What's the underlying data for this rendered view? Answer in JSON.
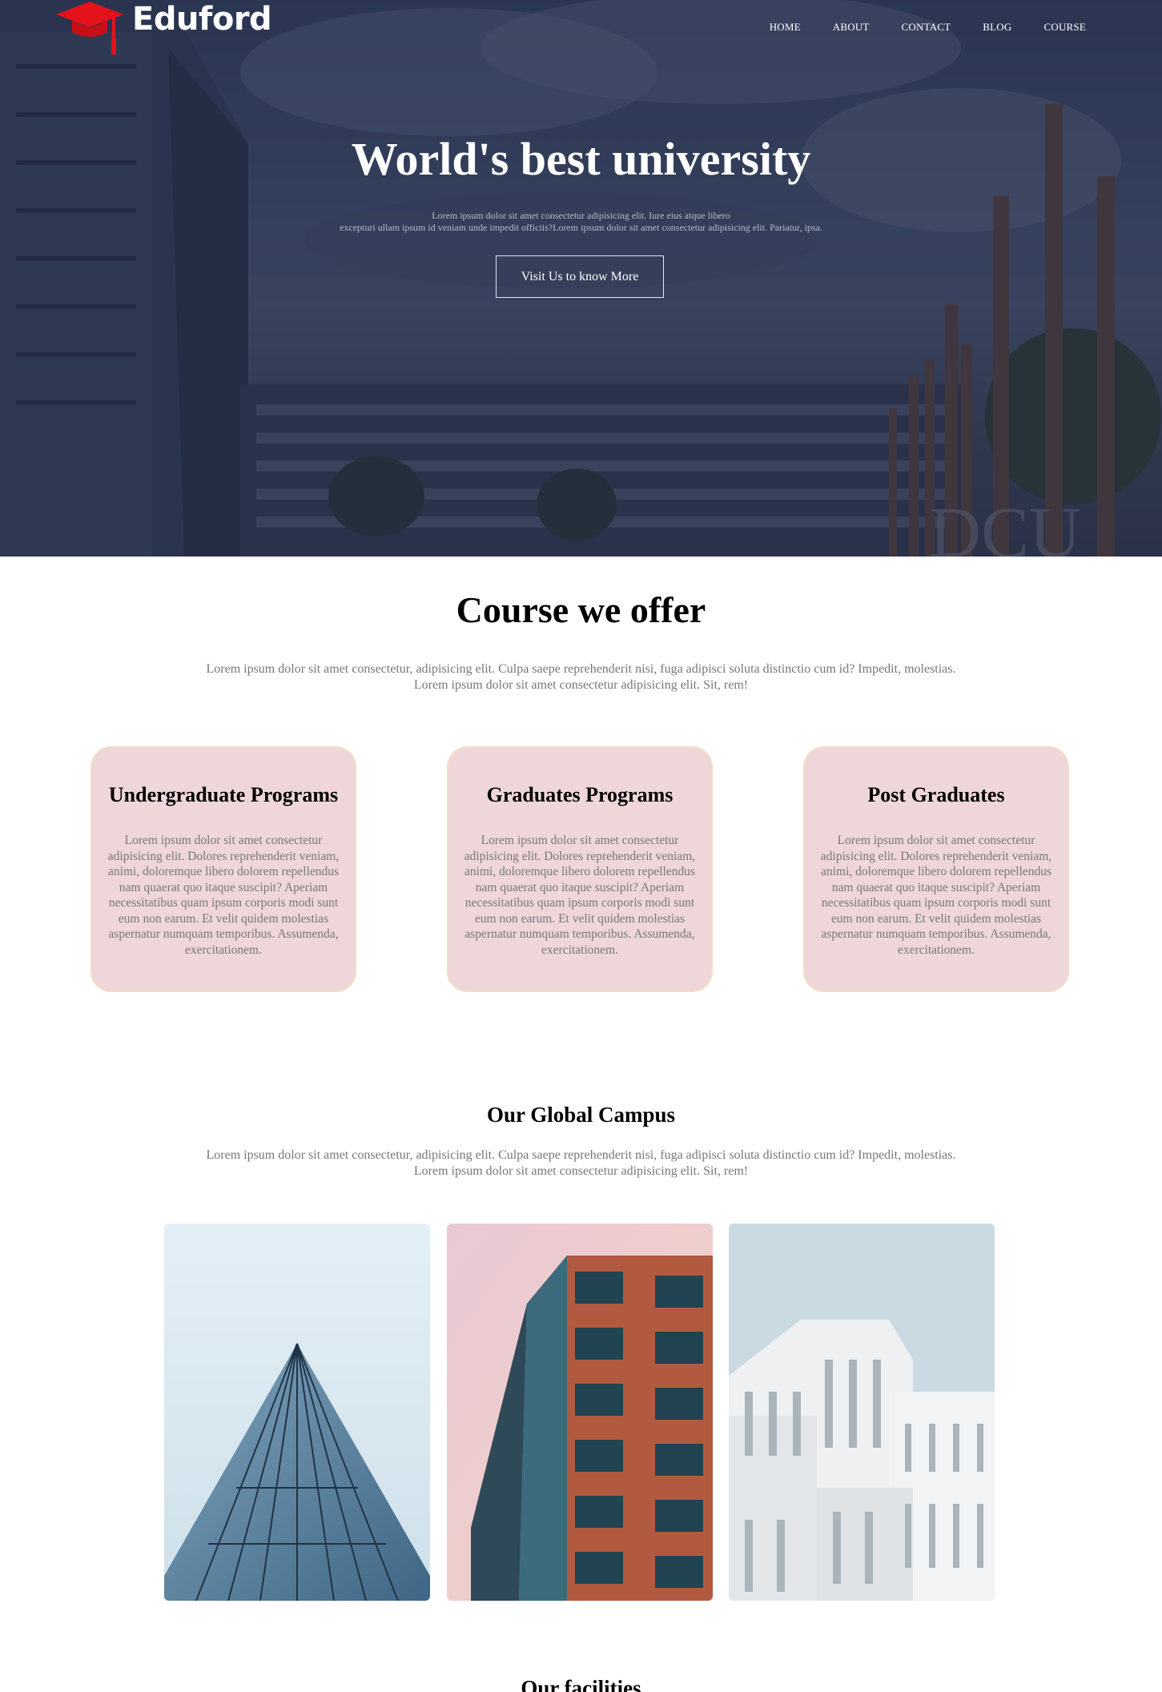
{
  "brand": {
    "name": "Eduford",
    "logo_icon": "graduation-cap-icon",
    "accent_color": "#e3121b"
  },
  "nav": {
    "items": [
      "HOME",
      "ABOUT",
      "CONTACT",
      "BLOG",
      "COURSE"
    ]
  },
  "hero": {
    "title": "World's best university",
    "subtitle_line1": "Lorem ipsum dolor sit amet consectetur adipisicing elit. Iure eius atque libero",
    "subtitle_line2": "excepturi ullam ipsum id veniam unde impedit officiis?Lorem ipsum dolor sit amet consectetur adipisicing elit. Pariatur, ipsa.",
    "button_label": "Visit Us to know More"
  },
  "courses": {
    "title": "Course we offer",
    "text_line1": "Lorem ipsum dolor sit amet consectetur, adipisicing elit. Culpa saepe reprehenderit nisi, fuga adipisci soluta distinctio cum id? Impedit, molestias.",
    "text_line2": "Lorem ipsum dolor sit amet consectetur adipisicing elit. Sit, rem!",
    "cards": [
      {
        "title": "Undergraduate Programs",
        "text": "Lorem ipsum dolor sit amet consectetur adipisicing elit. Dolores reprehenderit veniam, animi, doloremque libero dolorem repellendus nam quaerat quo itaque suscipit? Aperiam necessitatibus quam ipsum corporis modi sunt eum non earum. Et velit quidem molestias aspernatur numquam temporibus. Assumenda, exercitationem."
      },
      {
        "title": "Graduates Programs",
        "text": "Lorem ipsum dolor sit amet consectetur adipisicing elit. Dolores reprehenderit veniam, animi, doloremque libero dolorem repellendus nam quaerat quo itaque suscipit? Aperiam necessitatibus quam ipsum corporis modi sunt eum non earum. Et velit quidem molestias aspernatur numquam temporibus. Assumenda, exercitationem."
      },
      {
        "title": "Post Graduates",
        "text": "Lorem ipsum dolor sit amet consectetur adipisicing elit. Dolores reprehenderit veniam, animi, doloremque libero dolorem repellendus nam quaerat quo itaque suscipit? Aperiam necessitatibus quam ipsum corporis modi sunt eum non earum. Et velit quidem molestias aspernatur numquam temporibus. Assumenda, exercitationem."
      }
    ]
  },
  "campus": {
    "title": "Our Global Campus",
    "text_line1": "Lorem ipsum dolor sit amet consectetur, adipisicing elit. Culpa saepe reprehenderit nisi, fuga adipisci soluta distinctio cum id? Impedit, molestias.",
    "text_line2": "Lorem ipsum dolor sit amet consectetur adipisicing elit. Sit, rem!"
  },
  "facilities": {
    "title": "Our facilities"
  }
}
